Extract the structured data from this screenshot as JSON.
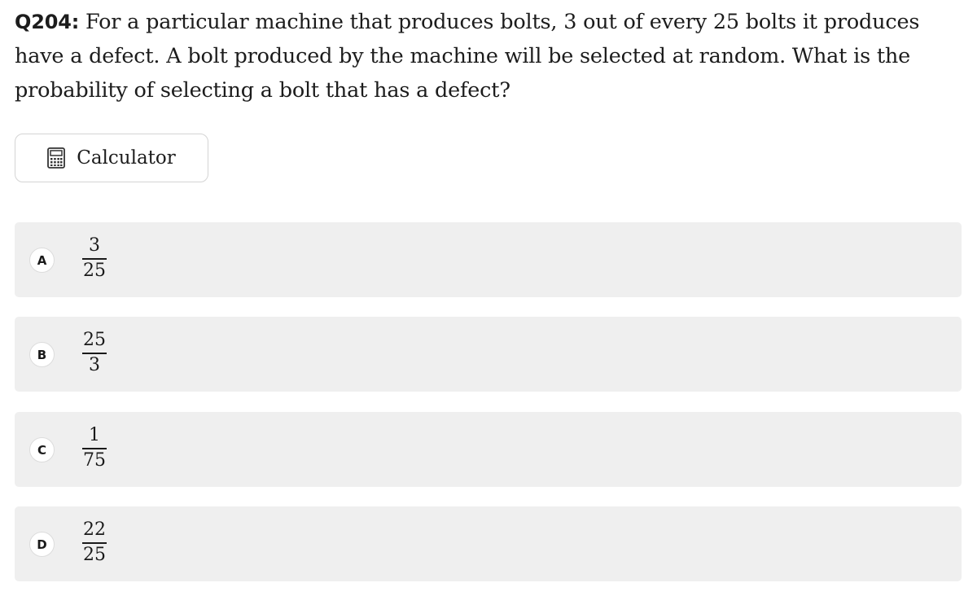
{
  "question": {
    "number": "Q204:",
    "text": "For a particular machine that produces bolts, 3 out of every 25 bolts it produces have a defect. A bolt produced by the machine will be selected at random. What is the probability of selecting a bolt that has a defect?"
  },
  "calculator": {
    "label": "Calculator",
    "icon": "calculator-icon"
  },
  "choices": [
    {
      "letter": "A",
      "numerator": "3",
      "denominator": "25"
    },
    {
      "letter": "B",
      "numerator": "25",
      "denominator": "3"
    },
    {
      "letter": "C",
      "numerator": "1",
      "denominator": "75"
    },
    {
      "letter": "D",
      "numerator": "22",
      "denominator": "25"
    }
  ],
  "colors": {
    "choice_background": "#efefef",
    "border": "#d4d4d4",
    "text": "#1c1c1c"
  }
}
